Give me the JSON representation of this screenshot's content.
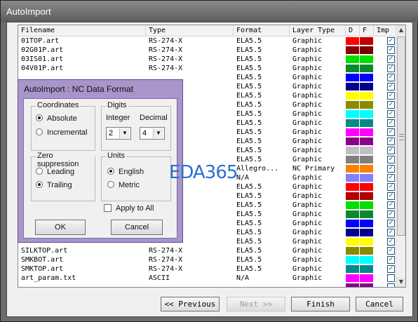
{
  "window": {
    "title": "AutoImport"
  },
  "list": {
    "headers": {
      "filename": "Filename",
      "type": "Type",
      "format": "Format",
      "layer_type": "Layer Type",
      "d": "D",
      "f": "F",
      "imp": "Imp"
    },
    "rows": [
      {
        "filename": "01TOP.art",
        "type": "RS-274-X",
        "format": "ELA5.5",
        "layer_type": "Graphic",
        "d": "#ff0000",
        "f": "#c00000",
        "checked": true
      },
      {
        "filename": "02G01P.art",
        "type": "RS-274-X",
        "format": "ELA5.5",
        "layer_type": "Graphic",
        "d": "#8b0000",
        "f": "#7a0000",
        "checked": true
      },
      {
        "filename": "03IS01.art",
        "type": "RS-274-X",
        "format": "ELA5.5",
        "layer_type": "Graphic",
        "d": "#00e000",
        "f": "#00e000",
        "checked": true
      },
      {
        "filename": "04V01P.art",
        "type": "RS-274-X",
        "format": "ELA5.5",
        "layer_type": "Graphic",
        "d": "#0a8a2a",
        "f": "#0a8a2a",
        "checked": true
      },
      {
        "filename": "",
        "type": "",
        "format": "ELA5.5",
        "layer_type": "Graphic",
        "d": "#0000ff",
        "f": "#0000ff",
        "checked": true
      },
      {
        "filename": "",
        "type": "",
        "format": "ELA5.5",
        "layer_type": "Graphic",
        "d": "#00008b",
        "f": "#00008b",
        "checked": true
      },
      {
        "filename": "",
        "type": "",
        "format": "ELA5.5",
        "layer_type": "Graphic",
        "d": "#ffff00",
        "f": "#ffff00",
        "checked": true
      },
      {
        "filename": "",
        "type": "",
        "format": "ELA5.5",
        "layer_type": "Graphic",
        "d": "#8b8b00",
        "f": "#8b8b00",
        "checked": true
      },
      {
        "filename": "",
        "type": "",
        "format": "ELA5.5",
        "layer_type": "Graphic",
        "d": "#00ffff",
        "f": "#00ffff",
        "checked": true
      },
      {
        "filename": "",
        "type": "",
        "format": "ELA5.5",
        "layer_type": "Graphic",
        "d": "#008b8b",
        "f": "#008b8b",
        "checked": true
      },
      {
        "filename": "",
        "type": "",
        "format": "ELA5.5",
        "layer_type": "Graphic",
        "d": "#ff00ff",
        "f": "#ff00ff",
        "checked": true
      },
      {
        "filename": "",
        "type": "",
        "format": "ELA5.5",
        "layer_type": "Graphic",
        "d": "#8b008b",
        "f": "#8b008b",
        "checked": true
      },
      {
        "filename": "",
        "type": "",
        "format": "ELA5.5",
        "layer_type": "Graphic",
        "d": "#c0c0c0",
        "f": "#c0c0c0",
        "checked": true
      },
      {
        "filename": "",
        "type": "",
        "format": "ELA5.5",
        "layer_type": "Graphic",
        "d": "#808080",
        "f": "#808080",
        "checked": true
      },
      {
        "filename": "",
        "type": "",
        "format": "Allegro...",
        "layer_type": "NC Primary",
        "d": "#ff8000",
        "f": "#ff8000",
        "checked": true
      },
      {
        "filename": "",
        "type": "",
        "format": "N/A",
        "layer_type": "Graphic",
        "d": "#8080ff",
        "f": "#8080ff",
        "checked": true
      },
      {
        "filename": "",
        "type": "",
        "format": "ELA5.5",
        "layer_type": "Graphic",
        "d": "#ff0000",
        "f": "#ff0000",
        "checked": true
      },
      {
        "filename": "",
        "type": "",
        "format": "ELA5.5",
        "layer_type": "Graphic",
        "d": "#b00000",
        "f": "#b00000",
        "checked": true
      },
      {
        "filename": "",
        "type": "",
        "format": "ELA5.5",
        "layer_type": "Graphic",
        "d": "#00e000",
        "f": "#00e000",
        "checked": true
      },
      {
        "filename": "",
        "type": "",
        "format": "ELA5.5",
        "layer_type": "Graphic",
        "d": "#0a8a2a",
        "f": "#0a8a2a",
        "checked": true
      },
      {
        "filename": "",
        "type": "",
        "format": "ELA5.5",
        "layer_type": "Graphic",
        "d": "#0000ff",
        "f": "#0000ff",
        "checked": true
      },
      {
        "filename": "",
        "type": "",
        "format": "ELA5.5",
        "layer_type": "Graphic",
        "d": "#00008b",
        "f": "#00008b",
        "checked": true
      },
      {
        "filename": "",
        "type": "",
        "format": "ELA5.5",
        "layer_type": "Graphic",
        "d": "#ffff00",
        "f": "#ffff00",
        "checked": true
      },
      {
        "filename": "SILKTOP.art",
        "type": "RS-274-X",
        "format": "ELA5.5",
        "layer_type": "Graphic",
        "d": "#8b8b00",
        "f": "#8b8b00",
        "checked": true
      },
      {
        "filename": "SMKBOT.art",
        "type": "RS-274-X",
        "format": "ELA5.5",
        "layer_type": "Graphic",
        "d": "#00ffff",
        "f": "#00ffff",
        "checked": true
      },
      {
        "filename": "SMKTOP.art",
        "type": "RS-274-X",
        "format": "ELA5.5",
        "layer_type": "Graphic",
        "d": "#008b8b",
        "f": "#008b8b",
        "checked": true
      },
      {
        "filename": "art_param.txt",
        "type": "ASCII",
        "format": "N/A",
        "layer_type": "Graphic",
        "d": "#ff00ff",
        "f": "#ff00ff",
        "checked": false
      },
      {
        "filename": "",
        "type": "",
        "format": "",
        "layer_type": "",
        "d": "#8b008b",
        "f": "#8b008b",
        "checked": false
      }
    ]
  },
  "buttons": {
    "previous": "<< Previous",
    "next": "Next >>",
    "finish": "Finish",
    "cancel": "Cancel"
  },
  "dialog": {
    "title": "AutoImport : NC Data Format",
    "coordinates": {
      "label": "Coordinates",
      "absolute": "Absolute",
      "incremental": "Incremental",
      "selected": "absolute"
    },
    "digits": {
      "label": "Digits",
      "integer_label": "Integer",
      "decimal_label": "Decimal",
      "integer": "2",
      "decimal": "4"
    },
    "zero_suppression": {
      "label": "Zero suppression",
      "leading": "Leading",
      "trailing": "Trailing",
      "selected": "trailing"
    },
    "units": {
      "label": "Units",
      "english": "English",
      "metric": "Metric",
      "selected": "english"
    },
    "apply_to_all": "Apply to All",
    "ok": "OK",
    "cancel": "Cancel"
  },
  "watermark": "EDA365"
}
